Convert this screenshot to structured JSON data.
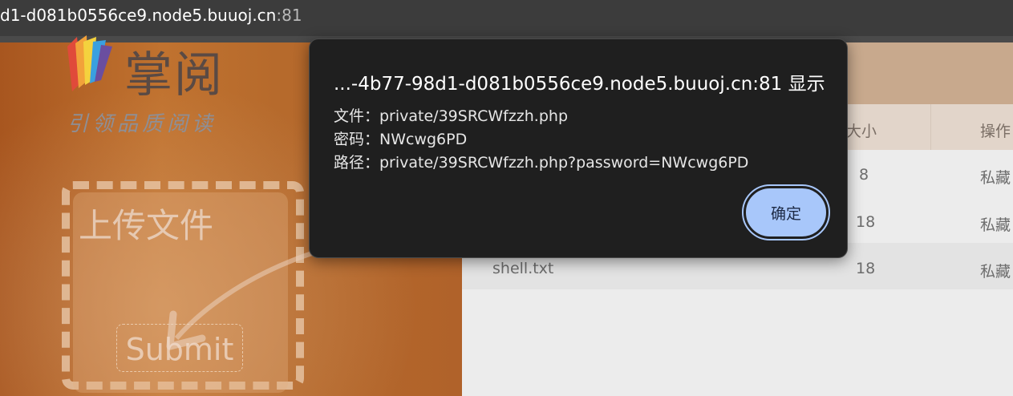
{
  "browser": {
    "url_host": "d1-d081b0556ce9.node5.buuoj.cn",
    "url_port": ":81"
  },
  "brand": {
    "name": "掌阅",
    "slogan": "引领品质阅读",
    "logo_colors": [
      "#e04a3a",
      "#f2a23a",
      "#f4d23e",
      "#3aa0e0",
      "#6a4ea0"
    ]
  },
  "upload": {
    "title": "上传文件",
    "submit_label": "Submit"
  },
  "table": {
    "headers": [
      "大小",
      "操作"
    ],
    "rows": [
      {
        "name": "",
        "size": "8",
        "action": "私藏"
      },
      {
        "name": "",
        "size": "18",
        "action": "私藏"
      },
      {
        "name": "shell.txt",
        "size": "18",
        "action": "私藏"
      }
    ]
  },
  "dialog": {
    "title": "...-4b77-98d1-d081b0556ce9.node5.buuoj.cn:81 显示",
    "lines": [
      "文件：private/39SRCWfzzh.php",
      "密码：NWcwg6PD",
      "路径：private/39SRCWfzzh.php?password=NWcwg6PD"
    ],
    "ok_label": "确定",
    "accent_color": "#a8c7fa"
  }
}
